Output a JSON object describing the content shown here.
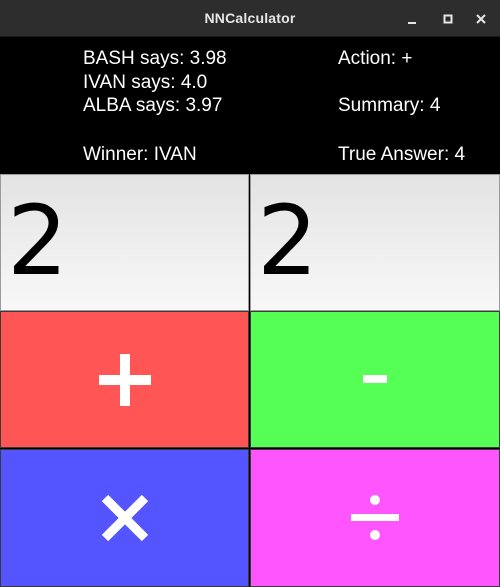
{
  "window": {
    "title": "NNCalculator"
  },
  "info": {
    "bash": "BASH says: 3.98",
    "ivan": "IVAN says: 4.0",
    "alba": "ALBA says: 3.97",
    "winner": "Winner: IVAN",
    "action": "Action: +",
    "summary": "Summary: 4",
    "true_answer": "True Answer: 4"
  },
  "display": {
    "operand_a": "2",
    "operand_b": "2"
  },
  "operators": {
    "add": {
      "icon": "plus-icon",
      "color": "#ff5555"
    },
    "subtract": {
      "icon": "minus-icon",
      "color": "#55ff55"
    },
    "multiply": {
      "icon": "times-icon",
      "color": "#5555ff"
    },
    "divide": {
      "icon": "divide-icon",
      "color": "#ff55ff"
    }
  }
}
